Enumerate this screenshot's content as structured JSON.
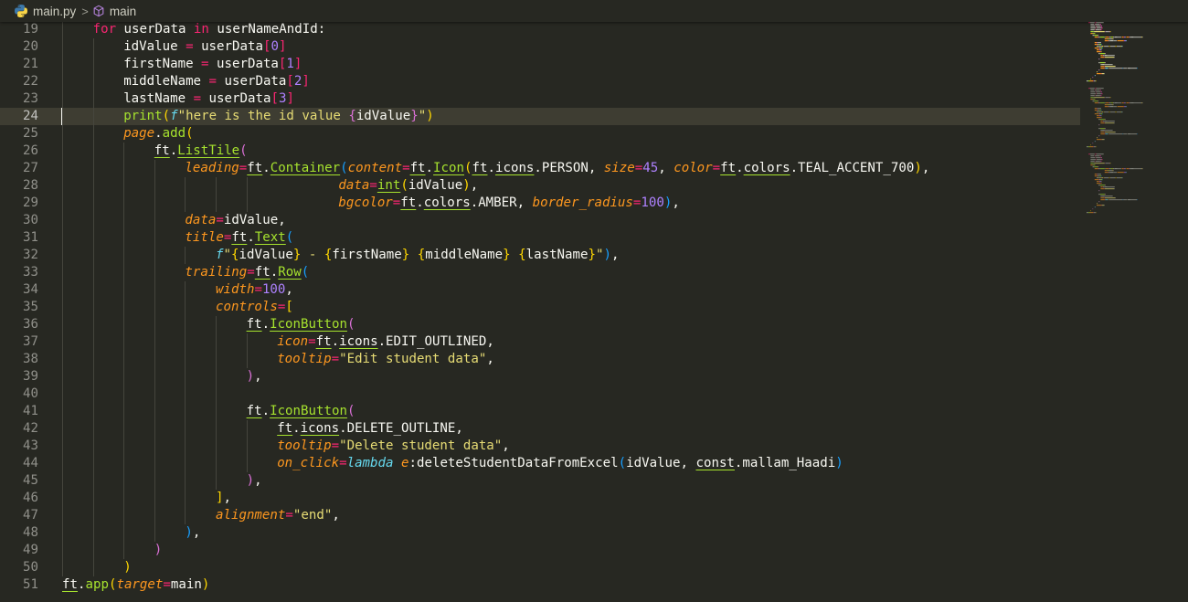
{
  "breadcrumb": {
    "file_icon": "python-file-icon",
    "file": "main.py",
    "separator": ">",
    "symbol_icon": "cube-method-icon",
    "symbol": "main"
  },
  "editor": {
    "current_line": 24,
    "theme": {
      "background": "#272822",
      "line_highlight": "#3e3d32",
      "keyword": "#f92672",
      "string": "#e6db74",
      "number": "#ae81ff",
      "function": "#a6e22e",
      "parameter": "#fd971f",
      "storage": "#66d9ef"
    },
    "lines": [
      {
        "n": "19",
        "indent": 1,
        "t": [
          [
            "kw",
            "for"
          ],
          [
            "plain",
            " userData "
          ],
          [
            "kw",
            "in"
          ],
          [
            "plain",
            " userNameAndId:"
          ]
        ]
      },
      {
        "n": "20",
        "indent": 2,
        "t": [
          [
            "plain",
            "idValue "
          ],
          [
            "op",
            "="
          ],
          [
            "plain",
            " userData"
          ],
          [
            "op",
            "["
          ],
          [
            "num",
            "0"
          ],
          [
            "op",
            "]"
          ]
        ]
      },
      {
        "n": "21",
        "indent": 2,
        "t": [
          [
            "plain",
            "firstName "
          ],
          [
            "op",
            "="
          ],
          [
            "plain",
            " userData"
          ],
          [
            "op",
            "["
          ],
          [
            "num",
            "1"
          ],
          [
            "op",
            "]"
          ]
        ]
      },
      {
        "n": "22",
        "indent": 2,
        "t": [
          [
            "plain",
            "middleName "
          ],
          [
            "op",
            "="
          ],
          [
            "plain",
            " userData"
          ],
          [
            "op",
            "["
          ],
          [
            "num",
            "2"
          ],
          [
            "op",
            "]"
          ]
        ]
      },
      {
        "n": "23",
        "indent": 2,
        "t": [
          [
            "plain",
            "lastName "
          ],
          [
            "op",
            "="
          ],
          [
            "plain",
            " userData"
          ],
          [
            "op",
            "["
          ],
          [
            "num",
            "3"
          ],
          [
            "op",
            "]"
          ]
        ]
      },
      {
        "n": "24",
        "indent": 2,
        "t": [
          [
            "fn",
            "print"
          ],
          [
            "p1",
            "("
          ],
          [
            "fmt",
            "f"
          ],
          [
            "str",
            "\"here is the id value "
          ],
          [
            "p2",
            "{"
          ],
          [
            "plain",
            "idValue"
          ],
          [
            "p2",
            "}"
          ],
          [
            "str",
            "\""
          ],
          [
            "p1",
            ")"
          ]
        ]
      },
      {
        "n": "25",
        "indent": 2,
        "t": [
          [
            "param",
            "page"
          ],
          [
            "plain",
            "."
          ],
          [
            "fn",
            "add"
          ],
          [
            "p1",
            "("
          ]
        ]
      },
      {
        "n": "26",
        "indent": 3,
        "t": [
          [
            "mod",
            "ft"
          ],
          [
            "plain",
            "."
          ],
          [
            "cls",
            "ListTile"
          ],
          [
            "p2",
            "("
          ]
        ]
      },
      {
        "n": "27",
        "indent": 4,
        "t": [
          [
            "kwarg",
            "leading"
          ],
          [
            "op",
            "="
          ],
          [
            "mod",
            "ft"
          ],
          [
            "plain",
            "."
          ],
          [
            "cls",
            "Container"
          ],
          [
            "p3",
            "("
          ],
          [
            "kwarg",
            "content"
          ],
          [
            "op",
            "="
          ],
          [
            "mod",
            "ft"
          ],
          [
            "plain",
            "."
          ],
          [
            "cls",
            "Icon"
          ],
          [
            "p1",
            "("
          ],
          [
            "mod",
            "ft"
          ],
          [
            "plain",
            "."
          ],
          [
            "mod",
            "icons"
          ],
          [
            "plain",
            ".PERSON, "
          ],
          [
            "kwarg",
            "size"
          ],
          [
            "op",
            "="
          ],
          [
            "num",
            "45"
          ],
          [
            "plain",
            ", "
          ],
          [
            "kwarg",
            "color"
          ],
          [
            "op",
            "="
          ],
          [
            "mod",
            "ft"
          ],
          [
            "plain",
            "."
          ],
          [
            "mod",
            "colors"
          ],
          [
            "plain",
            ".TEAL_ACCENT_700"
          ],
          [
            "p1",
            ")"
          ],
          [
            "plain",
            ","
          ]
        ]
      },
      {
        "n": "28",
        "indent": 9,
        "t": [
          [
            "kwarg",
            "data"
          ],
          [
            "op",
            "="
          ],
          [
            "cls",
            "int"
          ],
          [
            "p1",
            "("
          ],
          [
            "plain",
            "idValue"
          ],
          [
            "p1",
            ")"
          ],
          [
            "plain",
            ","
          ]
        ]
      },
      {
        "n": "29",
        "indent": 9,
        "t": [
          [
            "kwarg",
            "bgcolor"
          ],
          [
            "op",
            "="
          ],
          [
            "mod",
            "ft"
          ],
          [
            "plain",
            "."
          ],
          [
            "mod",
            "colors"
          ],
          [
            "plain",
            ".AMBER, "
          ],
          [
            "kwarg",
            "border_radius"
          ],
          [
            "op",
            "="
          ],
          [
            "num",
            "100"
          ],
          [
            "p3",
            ")"
          ],
          [
            "plain",
            ","
          ]
        ]
      },
      {
        "n": "30",
        "indent": 4,
        "t": [
          [
            "kwarg",
            "data"
          ],
          [
            "op",
            "="
          ],
          [
            "plain",
            "idValue,"
          ]
        ]
      },
      {
        "n": "31",
        "indent": 4,
        "t": [
          [
            "kwarg",
            "title"
          ],
          [
            "op",
            "="
          ],
          [
            "mod",
            "ft"
          ],
          [
            "plain",
            "."
          ],
          [
            "cls",
            "Text"
          ],
          [
            "p3",
            "("
          ]
        ]
      },
      {
        "n": "32",
        "indent": 5,
        "t": [
          [
            "fmt",
            "f"
          ],
          [
            "str",
            "\""
          ],
          [
            "p1",
            "{"
          ],
          [
            "plain",
            "idValue"
          ],
          [
            "p1",
            "}"
          ],
          [
            "str",
            " - "
          ],
          [
            "p1",
            "{"
          ],
          [
            "plain",
            "firstName"
          ],
          [
            "p1",
            "}"
          ],
          [
            "str",
            " "
          ],
          [
            "p1",
            "{"
          ],
          [
            "plain",
            "middleName"
          ],
          [
            "p1",
            "}"
          ],
          [
            "str",
            " "
          ],
          [
            "p1",
            "{"
          ],
          [
            "plain",
            "lastName"
          ],
          [
            "p1",
            "}"
          ],
          [
            "str",
            "\""
          ],
          [
            "p3",
            ")"
          ],
          [
            "plain",
            ","
          ]
        ]
      },
      {
        "n": "33",
        "indent": 4,
        "t": [
          [
            "kwarg",
            "trailing"
          ],
          [
            "op",
            "="
          ],
          [
            "mod",
            "ft"
          ],
          [
            "plain",
            "."
          ],
          [
            "cls",
            "Row"
          ],
          [
            "p3",
            "("
          ]
        ]
      },
      {
        "n": "34",
        "indent": 5,
        "t": [
          [
            "kwarg",
            "width"
          ],
          [
            "op",
            "="
          ],
          [
            "num",
            "100"
          ],
          [
            "plain",
            ","
          ]
        ]
      },
      {
        "n": "35",
        "indent": 5,
        "t": [
          [
            "kwarg",
            "controls"
          ],
          [
            "op",
            "="
          ],
          [
            "p1",
            "["
          ]
        ]
      },
      {
        "n": "36",
        "indent": 6,
        "t": [
          [
            "mod",
            "ft"
          ],
          [
            "plain",
            "."
          ],
          [
            "cls",
            "IconButton"
          ],
          [
            "p2",
            "("
          ]
        ]
      },
      {
        "n": "37",
        "indent": 7,
        "t": [
          [
            "kwarg",
            "icon"
          ],
          [
            "op",
            "="
          ],
          [
            "mod",
            "ft"
          ],
          [
            "plain",
            "."
          ],
          [
            "mod",
            "icons"
          ],
          [
            "plain",
            ".EDIT_OUTLINED,"
          ]
        ]
      },
      {
        "n": "38",
        "indent": 7,
        "t": [
          [
            "kwarg",
            "tooltip"
          ],
          [
            "op",
            "="
          ],
          [
            "str",
            "\"Edit student data\""
          ],
          [
            "plain",
            ","
          ]
        ]
      },
      {
        "n": "39",
        "indent": 6,
        "t": [
          [
            "p2",
            ")"
          ],
          [
            "plain",
            ","
          ]
        ]
      },
      {
        "n": "40",
        "indent": 6,
        "t": []
      },
      {
        "n": "41",
        "indent": 6,
        "t": [
          [
            "mod",
            "ft"
          ],
          [
            "plain",
            "."
          ],
          [
            "cls",
            "IconButton"
          ],
          [
            "p2",
            "("
          ]
        ]
      },
      {
        "n": "42",
        "indent": 7,
        "t": [
          [
            "mod",
            "ft"
          ],
          [
            "plain",
            "."
          ],
          [
            "mod",
            "icons"
          ],
          [
            "plain",
            ".DELETE_OUTLINE,"
          ]
        ]
      },
      {
        "n": "43",
        "indent": 7,
        "t": [
          [
            "kwarg",
            "tooltip"
          ],
          [
            "op",
            "="
          ],
          [
            "str",
            "\"Delete student data\""
          ],
          [
            "plain",
            ","
          ]
        ]
      },
      {
        "n": "44",
        "indent": 7,
        "t": [
          [
            "kwarg",
            "on_click"
          ],
          [
            "op",
            "="
          ],
          [
            "storage",
            "lambda"
          ],
          [
            "plain",
            " "
          ],
          [
            "param",
            "e"
          ],
          [
            "plain",
            ":deleteStudentDataFromExcel"
          ],
          [
            "p3",
            "("
          ],
          [
            "plain",
            "idValue, "
          ],
          [
            "mod",
            "const"
          ],
          [
            "plain",
            ".mallam_Haadi"
          ],
          [
            "p3",
            ")"
          ]
        ]
      },
      {
        "n": "45",
        "indent": 6,
        "t": [
          [
            "p2",
            ")"
          ],
          [
            "plain",
            ","
          ]
        ]
      },
      {
        "n": "46",
        "indent": 5,
        "t": [
          [
            "p1",
            "]"
          ],
          [
            "plain",
            ","
          ]
        ]
      },
      {
        "n": "47",
        "indent": 5,
        "t": [
          [
            "kwarg",
            "alignment"
          ],
          [
            "op",
            "="
          ],
          [
            "str",
            "\"end\""
          ],
          [
            "plain",
            ","
          ]
        ]
      },
      {
        "n": "48",
        "indent": 4,
        "t": [
          [
            "p3",
            ")"
          ],
          [
            "plain",
            ","
          ]
        ]
      },
      {
        "n": "49",
        "indent": 3,
        "t": [
          [
            "p2",
            ")"
          ]
        ]
      },
      {
        "n": "50",
        "indent": 2,
        "t": [
          [
            "p1",
            ")"
          ]
        ]
      },
      {
        "n": "51",
        "indent": 0,
        "t": [
          [
            "mod",
            "ft"
          ],
          [
            "plain",
            "."
          ],
          [
            "fn",
            "app"
          ],
          [
            "p1",
            "("
          ],
          [
            "kwarg",
            "target"
          ],
          [
            "op",
            "="
          ],
          [
            "plain",
            "main"
          ],
          [
            "p1",
            ")"
          ]
        ]
      }
    ]
  }
}
